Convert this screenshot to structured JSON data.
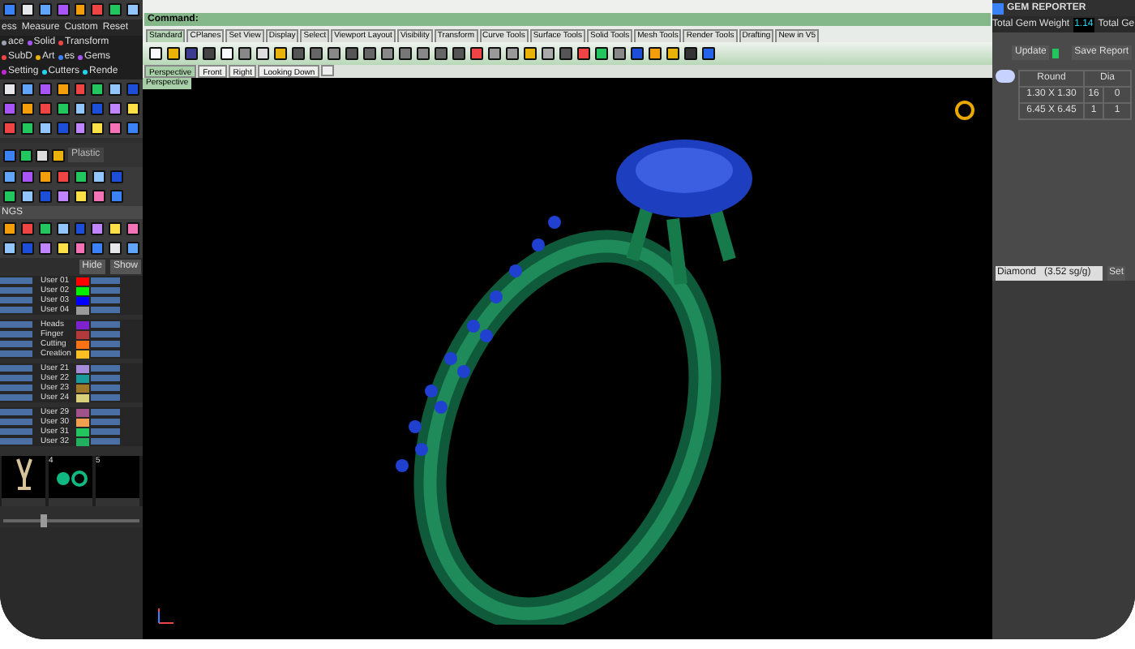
{
  "left_panel": {
    "menu": [
      "ess",
      "Measure",
      "Custom",
      "Reset"
    ],
    "categories": [
      {
        "label": "ace",
        "color": "#9ca3af"
      },
      {
        "label": "Solid",
        "color": "#a855f7"
      },
      {
        "label": "Transform",
        "color": "#ef4444"
      },
      {
        "label": "SubD",
        "color": "#ef4444"
      },
      {
        "label": "Art",
        "color": "#eab308"
      },
      {
        "label": "es",
        "color": "#3b82f6"
      },
      {
        "label": "Gems",
        "color": "#a855f7"
      },
      {
        "label": "Setting",
        "color": "#c026d3"
      },
      {
        "label": "Cutters",
        "color": "#22d3ee"
      },
      {
        "label": "Rende",
        "color": "#22d3ee"
      }
    ],
    "material": "Plastic",
    "thumbnail_zoom": {
      "level": 0.3
    },
    "section_heading": "NGS",
    "hide_button": "Hide",
    "show_button": "Show",
    "layer_groups": [
      [
        {
          "name": "User 01",
          "color": "#ff0000"
        },
        {
          "name": "User 02",
          "color": "#00ee00"
        },
        {
          "name": "User 03",
          "color": "#0000ff"
        },
        {
          "name": "User 04",
          "color": "#9a9a9a"
        }
      ],
      [
        {
          "name": "Heads",
          "color": "#7e22ce"
        },
        {
          "name": "Finger",
          "color": "#b33a3a"
        },
        {
          "name": "Cutting",
          "color": "#f97316"
        },
        {
          "name": "Creation",
          "color": "#fbbf24"
        }
      ],
      [
        {
          "name": "User 21",
          "color": "#a78bdb"
        },
        {
          "name": "User 22",
          "color": "#1a9a9a"
        },
        {
          "name": "User 23",
          "color": "#a0782a"
        },
        {
          "name": "User 24",
          "color": "#d8d07a"
        }
      ],
      [
        {
          "name": "User 29",
          "color": "#a0528a"
        },
        {
          "name": "User 30",
          "color": "#f0a050"
        },
        {
          "name": "User 31",
          "color": "#22c55e"
        },
        {
          "name": "User 32",
          "color": "#22b060"
        }
      ]
    ],
    "thumbnails": [
      {
        "kind": "tower"
      },
      {
        "number": "4",
        "kind": "rings"
      },
      {
        "number": "5",
        "kind": "empty"
      }
    ]
  },
  "command": {
    "label": "Command:"
  },
  "toolbar_tabs": [
    {
      "label": "Standard",
      "selected": true
    },
    {
      "label": "CPlanes",
      "selected": false
    },
    {
      "label": "Set View",
      "selected": false
    },
    {
      "label": "Display",
      "selected": false
    },
    {
      "label": "Select",
      "selected": false
    },
    {
      "label": "Viewport Layout",
      "selected": false
    },
    {
      "label": "Visibility",
      "selected": false
    },
    {
      "label": "Transform",
      "selected": false
    },
    {
      "label": "Curve Tools",
      "selected": false
    },
    {
      "label": "Surface Tools",
      "selected": false
    },
    {
      "label": "Solid Tools",
      "selected": false
    },
    {
      "label": "Mesh Tools",
      "selected": false
    },
    {
      "label": "Render Tools",
      "selected": false
    },
    {
      "label": "Drafting",
      "selected": false
    },
    {
      "label": "New in V5",
      "selected": false
    }
  ],
  "viewport_tabs": [
    {
      "label": "Perspective",
      "selected": true
    },
    {
      "label": "Front",
      "selected": false
    },
    {
      "label": "Right",
      "selected": false
    },
    {
      "label": "Looking Down",
      "selected": false
    }
  ],
  "viewport": {
    "title": "Perspective"
  },
  "gem_reporter": {
    "title": "GEM REPORTER",
    "weight_label": "Total Gem Weight",
    "weight": "1.14",
    "second_label": "Total Ge",
    "update": "Update",
    "save": "Save Report",
    "columns": [
      "Round",
      "Dia"
    ],
    "rows": [
      [
        "1.30 X 1.30",
        "16",
        "0"
      ],
      [
        "6.45 X 6.45",
        "1",
        "1"
      ]
    ],
    "material": "Diamond   (3.52 sg/g)",
    "set": "Set"
  }
}
